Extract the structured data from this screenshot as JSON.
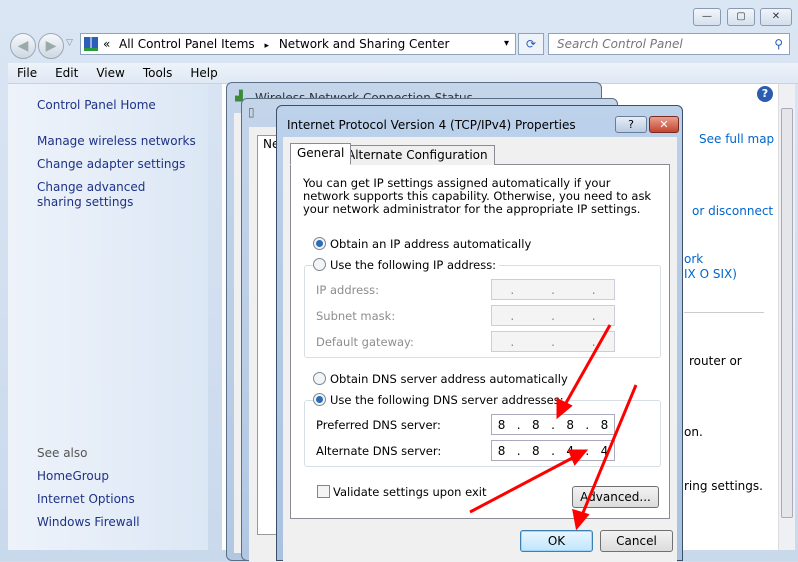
{
  "window": {
    "minimize": "—",
    "maximize": "▢",
    "close": "✕"
  },
  "address": {
    "prefix": "«",
    "crumbs": [
      "All Control Panel Items",
      "Network and Sharing Center"
    ],
    "separator": "▸",
    "dropdown": "▾",
    "refresh": "⟳"
  },
  "search": {
    "placeholder": "Search Control Panel",
    "icon": "search-icon"
  },
  "menu": [
    "File",
    "Edit",
    "View",
    "Tools",
    "Help"
  ],
  "sidebar": {
    "home": "Control Panel Home",
    "links": [
      "Manage wireless networks",
      "Change adapter settings",
      "Change advanced sharing settings"
    ],
    "see_also_title": "See also",
    "see_also": [
      "HomeGroup",
      "Internet Options",
      "Windows Firewall"
    ]
  },
  "main": {
    "see_full_map": "See full map",
    "or_disconnect": "or disconnect",
    "network_frag1": "ork",
    "network_frag2": "IX O SIX)",
    "router_frag": "router or",
    "on_frag": "on.",
    "sharing_frag": "ring settings."
  },
  "background_dialogs": {
    "status_title": "Wireless Network Connection Status",
    "ne_frag": "Ne"
  },
  "dialog": {
    "title": "Internet Protocol Version 4 (TCP/IPv4) Properties",
    "help": "?",
    "close": "✕",
    "tabs": [
      "General",
      "Alternate Configuration"
    ],
    "description": "You can get IP settings assigned automatically if your network supports this capability. Otherwise, you need to ask your network administrator for the appropriate IP settings.",
    "ip_auto": "Obtain an IP address automatically",
    "ip_manual": "Use the following IP address:",
    "ip_address_label": "IP address:",
    "subnet_label": "Subnet mask:",
    "gateway_label": "Default gateway:",
    "dns_auto": "Obtain DNS server address automatically",
    "dns_manual": "Use the following DNS server addresses:",
    "preferred_label": "Preferred DNS server:",
    "preferred_value": [
      "8",
      "8",
      "8",
      "8"
    ],
    "alternate_label": "Alternate DNS server:",
    "alternate_value": [
      "8",
      "8",
      "4",
      "4"
    ],
    "validate": "Validate settings upon exit",
    "validate_checked": false,
    "advanced": "Advanced...",
    "ok": "OK",
    "cancel": "Cancel"
  },
  "annotation_color": "#ff0000"
}
